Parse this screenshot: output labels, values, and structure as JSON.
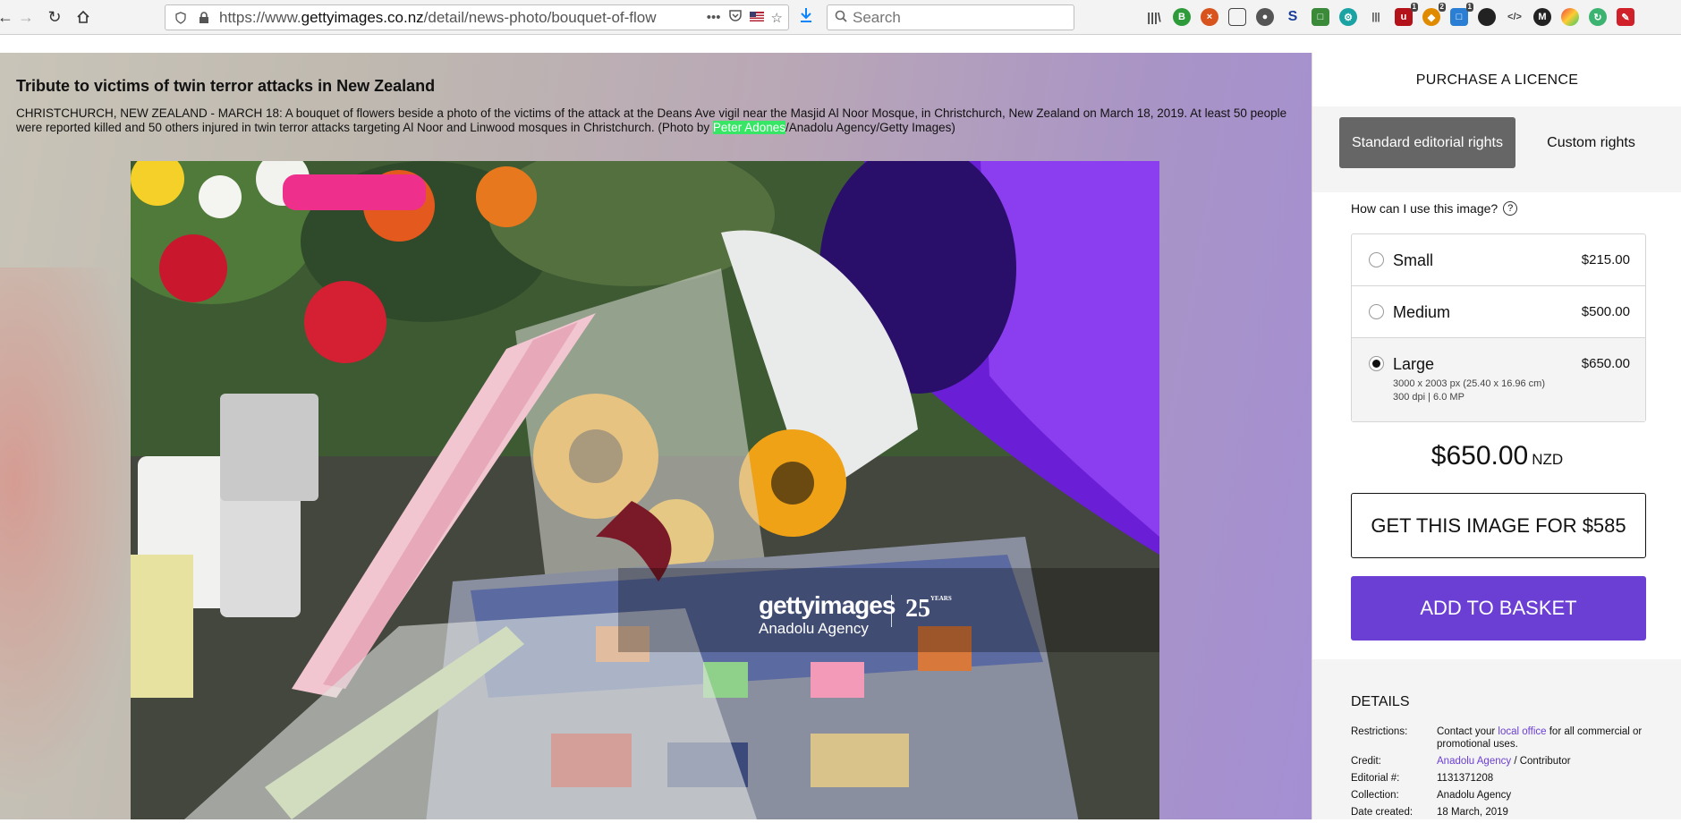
{
  "browser": {
    "url_prefix": "https://www.",
    "url_host": "gettyimages.co.nz",
    "url_path": "/detail/news-photo/bouquet-of-flow",
    "search_placeholder": "Search",
    "url_more": "•••",
    "extension_badges": [
      "1",
      "2",
      "1"
    ]
  },
  "article": {
    "headline": "Tribute to victims of twin terror attacks in New Zealand",
    "caption_before": "CHRISTCHURCH, NEW ZEALAND - MARCH 18: A bouquet of flowers beside a photo of the victims of the attack at the Deans Ave vigil near the Masjid Al Noor Mosque, in Christchurch, New Zealand on March 18, 2019. At least 50 people were reported killed and 50 others injured in twin terror attacks targeting Al Noor and Linwood mosques in Christchurch. (Photo by ",
    "caption_highlight": "Peter Adones",
    "caption_after": "/Anadolu Agency/Getty Images)"
  },
  "watermark": {
    "logo": "gettyimages",
    "agency": "Anadolu Agency",
    "years_number": "25",
    "years_word": "YEARS"
  },
  "purchase": {
    "title": "PURCHASE A LICENCE",
    "rights_standard": "Standard editorial rights",
    "rights_custom": "Custom rights",
    "how_use": "How can I use this image?",
    "help_glyph": "?",
    "sizes": [
      {
        "name": "Small",
        "price": "$215.00",
        "selected": false
      },
      {
        "name": "Medium",
        "price": "$500.00",
        "selected": false
      },
      {
        "name": "Large",
        "price": "$650.00",
        "selected": true,
        "dims": "3000 x 2003 px (25.40 x 16.96 cm)",
        "dpi": "300 dpi | 6.0 MP"
      }
    ],
    "total_amount": "$650.00",
    "currency": "NZD",
    "get_image_label": "GET THIS IMAGE FOR $585",
    "add_basket_label": "ADD TO BASKET",
    "accent_color": "#6b3fd4"
  },
  "details": {
    "title": "DETAILS",
    "restrictions_label": "Restrictions:",
    "restrictions_pre": "Contact your ",
    "restrictions_link": "local office",
    "restrictions_post": " for all commercial or promotional uses.",
    "credit_label": "Credit:",
    "credit_link": "Anadolu Agency",
    "credit_post": " / Contributor",
    "editorial_label": "Editorial #:",
    "editorial_value": "1131371208",
    "collection_label": "Collection:",
    "collection_value": "Anadolu Agency",
    "date_label": "Date created:",
    "date_value": "18 March, 2019"
  }
}
